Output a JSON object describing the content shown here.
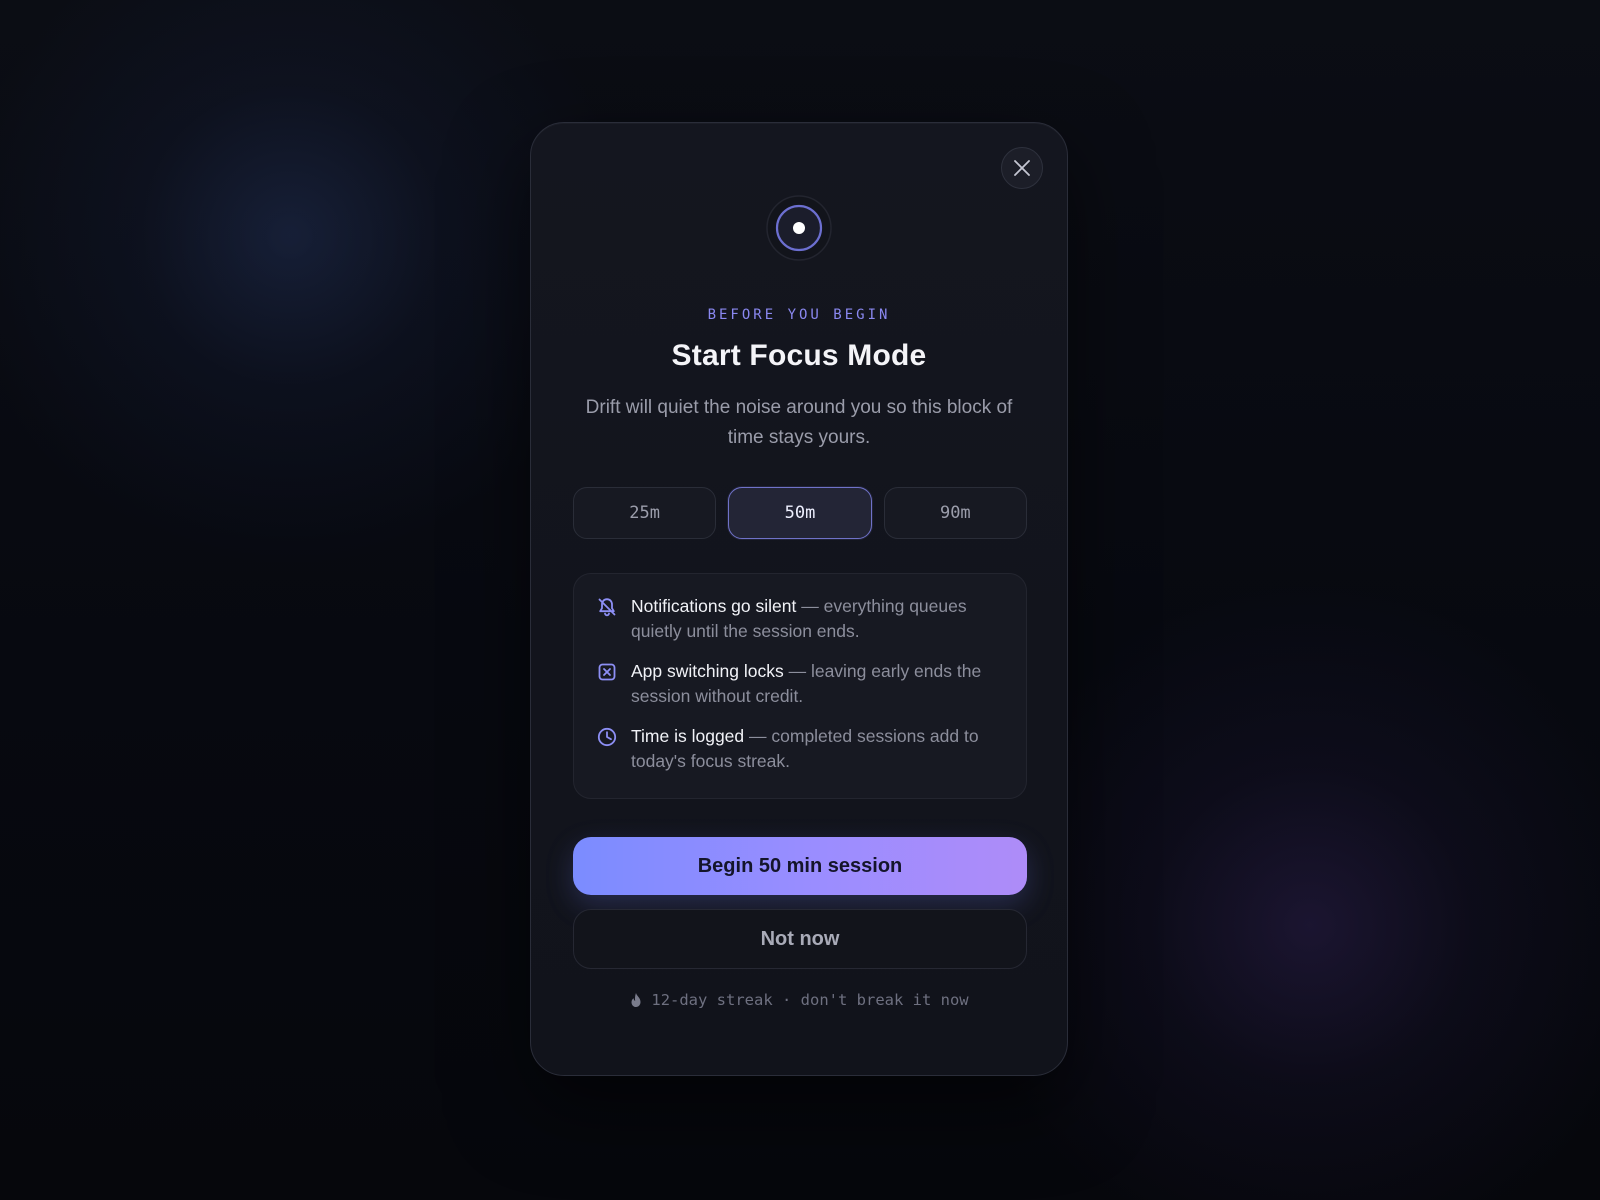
{
  "dialog": {
    "eyebrow": "BEFORE YOU BEGIN",
    "title": "Start Focus Mode",
    "subtitle": "Drift will quiet the noise around you so this block of time stays yours.",
    "close_icon": "close-icon",
    "header_icon": "focus-target-icon"
  },
  "durations": [
    {
      "label": "25m",
      "selected": false
    },
    {
      "label": "50m",
      "selected": true
    },
    {
      "label": "90m",
      "selected": false
    }
  ],
  "features": [
    {
      "icon": "bell-off-icon",
      "title": "Notifications go silent",
      "detail": " — everything queues quietly until the session ends."
    },
    {
      "icon": "app-lock-icon",
      "title": "App switching locks",
      "detail": " — leaving early ends the session without credit."
    },
    {
      "icon": "clock-icon",
      "title": "Time is logged",
      "detail": " — completed sessions add to today's focus streak."
    }
  ],
  "actions": {
    "primary_label": "Begin 50 min session",
    "secondary_label": "Not now"
  },
  "streak": {
    "icon": "flame-icon",
    "text": "12-day streak · don't break it now"
  },
  "colors": {
    "accent": "#8a88f0",
    "primary_gradient_start": "#7b8cff",
    "primary_gradient_end": "#ae8cf8",
    "modal_bg": "#14161f"
  }
}
